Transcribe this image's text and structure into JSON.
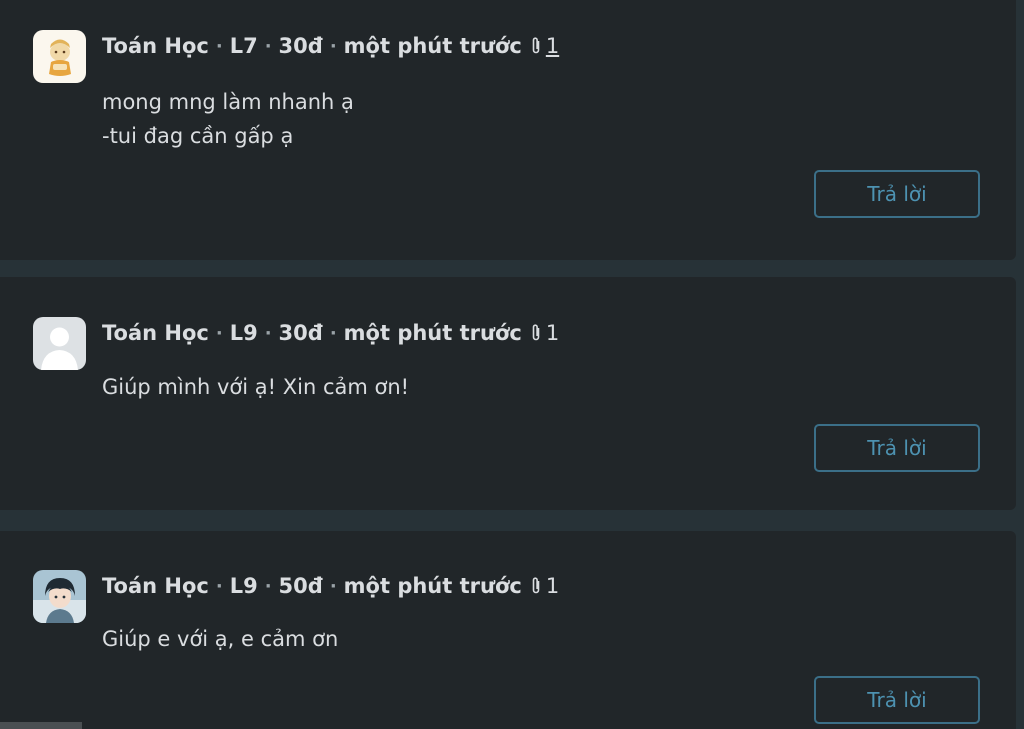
{
  "posts": [
    {
      "author": "Toán Học",
      "level": "L7",
      "points": "30đ",
      "time": "một phút trước",
      "attachments": "1",
      "lines": [
        "mong mng làm nhanh ạ",
        "-tui đag cần gấp ạ"
      ],
      "reply_label": "Trả lời"
    },
    {
      "author": "Toán Học",
      "level": "L9",
      "points": "30đ",
      "time": "một phút trước",
      "attachments": "1",
      "lines": [
        "Giúp mình với ạ! Xin cảm ơn!"
      ],
      "reply_label": "Trả lời"
    },
    {
      "author": "Toán Học",
      "level": "L9",
      "points": "50đ",
      "time": "một phút trước",
      "attachments": "1",
      "lines": [
        "Giúp e với ạ, e cảm ơn"
      ],
      "reply_label": "Trả lời"
    }
  ],
  "separator": "·",
  "colors": {
    "page_bg": "#273237",
    "card_bg": "#212629",
    "text": "#dadde0",
    "accent": "#4d92b1"
  },
  "icons": {
    "attachment": "paperclip-icon",
    "default_avatar": "user-silhouette-icon"
  }
}
